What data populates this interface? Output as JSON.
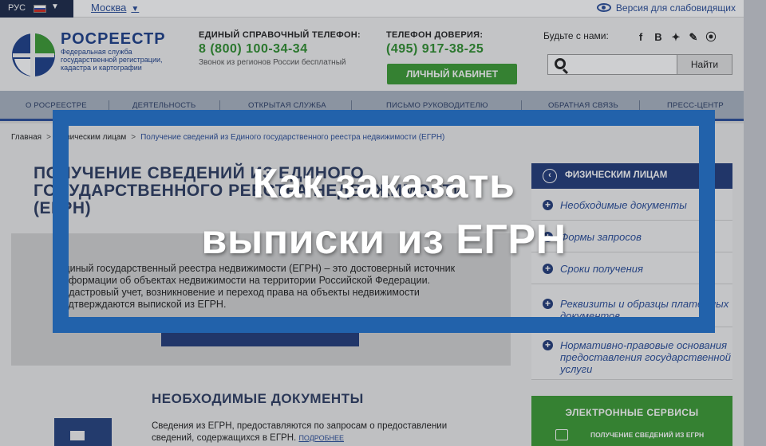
{
  "topbar": {
    "language": "РУС",
    "city": "Москва",
    "vision_link": "Версия для слабовидящих"
  },
  "logo": {
    "title": "РОСРЕЕСТР",
    "subtitle": "Федеральная служба государственной регистрации, кадастра и картографии"
  },
  "contacts": {
    "helpline_label": "ЕДИНЫЙ СПРАВОЧНЫЙ ТЕЛЕФОН:",
    "helpline_number": "8 (800) 100-34-34",
    "helpline_note": "Звонок из регионов России бесплатный",
    "trust_label": "ТЕЛЕФОН ДОВЕРИЯ:",
    "trust_number": "(495) 917-38-25",
    "cabinet_button": "ЛИЧНЫЙ КАБИНЕТ"
  },
  "social": {
    "label": "Будьте с нами:",
    "icons": [
      "f",
      "В",
      "✦",
      "✎",
      "⦿"
    ]
  },
  "search": {
    "placeholder": "",
    "button": "Найти"
  },
  "nav": {
    "items": [
      "О РОСРЕЕСТРЕ",
      "ДЕЯТЕЛЬНОСТЬ",
      "ОТКРЫТАЯ СЛУЖБА",
      "ПИСЬМО РУКОВОДИТЕЛЮ",
      "ОБРАТНАЯ СВЯЗЬ",
      "ПРЕСС-ЦЕНТР"
    ]
  },
  "breadcrumb": {
    "home": "Главная",
    "section": "Физическим лицам",
    "current": "Получение сведений из Единого государственного реестра недвижимости (ЕГРН)"
  },
  "main": {
    "title": "ПОЛУЧЕНИЕ СВЕДЕНИЙ ИЗ ЕДИНОГО ГОСУДАРСТВЕННОГО РЕЕСТРА НЕДВИЖИМОСТИ (ЕГРН)",
    "intro": "Единый государственный реестра недвижимости (ЕГРН) – это достоверный источник информации об объектах недвижимости на территории Российской Федерации. Кадастровый учет, возникновение и переход права на объекты недвижимости подтверждаются выпиской из ЕГРН.",
    "docs_title": "НЕОБХОДИМЫЕ ДОКУМЕНТЫ",
    "docs_text": "Сведения из ЕГРН, предоставляются по запросам о предоставлении сведений, содержащихся в ЕГРН.",
    "docs_more": "ПОДРОБНЕЕ"
  },
  "sidebar": {
    "header": "ФИЗИЧЕСКИМ ЛИЦАМ",
    "items": [
      "Необходимые документы",
      "Формы запросов",
      "Сроки получения",
      "Реквизиты и образцы платежных документов",
      "Нормативно-правовые основания предоставления государственной услуги"
    ],
    "services_title": "ЭЛЕКТРОННЫЕ СЕРВИСЫ",
    "services_item": "ПОЛУЧЕНИЕ СВЕДЕНИЙ ИЗ ЕГРН"
  },
  "overlay": {
    "line1": "Как заказать",
    "line2": "выписки из ЕГРН"
  },
  "colors": {
    "brand_blue": "#223b7a",
    "accent_green": "#3c9b34",
    "banner_frame": "#2262ab"
  }
}
